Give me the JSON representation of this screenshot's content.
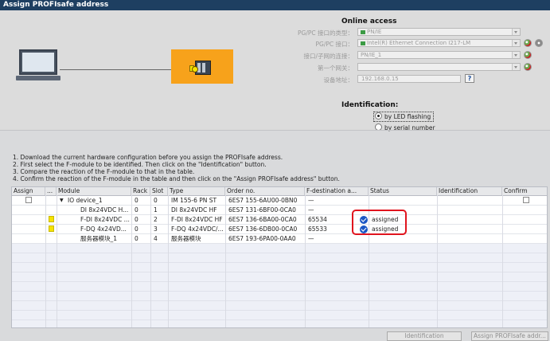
{
  "window": {
    "title": "Assign PROFIsafe address"
  },
  "online_access": {
    "title": "Online access",
    "fields": [
      {
        "label": "PG/PC 接口的类型：",
        "value": "PN/IE"
      },
      {
        "label": "PG/PC 接口：",
        "value": "Intel(R) Ethernet Connection I217-LM"
      },
      {
        "label": "接口/子网的连接：",
        "value": "PN/IE_1"
      },
      {
        "label": "第一个网关：",
        "value": ""
      },
      {
        "label": "设备地址：",
        "value": "192.168.0.15"
      }
    ]
  },
  "identification": {
    "title": "Identification:",
    "options": [
      {
        "label": "by LED flashing",
        "selected": true
      },
      {
        "label": "by serial number",
        "selected": false
      }
    ]
  },
  "instructions": [
    "1. Download the current hardware configuration before you assign the PROFIsafe address.",
    "2. First select the F-module to be identified. Then click on the \"Identification\" button.",
    "3. Compare the reaction of the F-module to that in the table.",
    "4. Confirm the reaction of the F-module in the table and then click on the \"Assign PROFIsafe address\" button."
  ],
  "table": {
    "columns": [
      "Assign",
      "...",
      "Module",
      "Rack",
      "Slot",
      "Type",
      "Order no.",
      "F-destination a...",
      "Status",
      "Identification",
      "Confirm"
    ],
    "rows": [
      {
        "module": "IO device_1",
        "rack": "0",
        "slot": "0",
        "type": "IM 155-6 PN ST",
        "order": "6ES7 155-6AU00-0BN0",
        "fdest": "—",
        "status": ""
      },
      {
        "module": "DI 8x24VDC H...",
        "rack": "0",
        "slot": "1",
        "type": "DI 8x24VDC HF",
        "order": "6ES7 131-6BF00-0CA0",
        "fdest": "—",
        "status": ""
      },
      {
        "module": "F-DI 8x24VDC ...",
        "rack": "0",
        "slot": "2",
        "type": "F-DI 8x24VDC HF",
        "order": "6ES7 136-6BA00-0CA0",
        "fdest": "65534",
        "status": "assigned"
      },
      {
        "module": "F-DQ 4x24VD...",
        "rack": "0",
        "slot": "3",
        "type": "F-DQ 4x24VDC/...",
        "order": "6ES7 136-6DB00-0CA0",
        "fdest": "65533",
        "status": "assigned"
      },
      {
        "module": "服务器模块_1",
        "rack": "0",
        "slot": "4",
        "type": "服务器模块",
        "order": "6ES7 193-6PA00-0AA0",
        "fdest": "—",
        "status": ""
      }
    ]
  },
  "buttons": {
    "identification": "Identification",
    "assign": "Assign PROFIsafe addr..."
  },
  "colors": {
    "title_bar": "#1e3f61",
    "device_box": "#f7a21b",
    "highlight": "#e0141e",
    "status_icon": "#1a56c4",
    "f_module_marker": "#f5e300"
  }
}
